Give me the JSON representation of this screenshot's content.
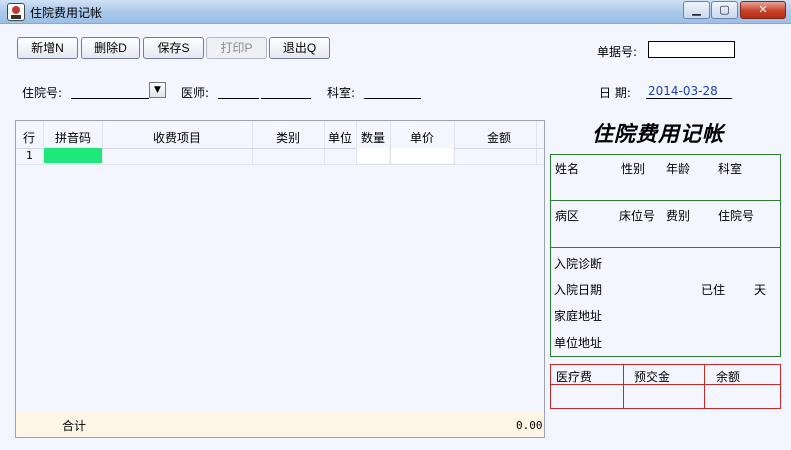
{
  "window": {
    "title": "住院费用记帐",
    "min": "0",
    "max": "1",
    "close": "r"
  },
  "toolbar": {
    "new": "新增N",
    "delete": "删除D",
    "save": "保存S",
    "print": "打印P",
    "exit": "退出Q"
  },
  "form": {
    "receipt_label": "单据号:",
    "inpatient_label": "住院号:",
    "doctor_label": "医师:",
    "dept_label": "科室:",
    "date_label": "日  期:",
    "date_value": "2014-03-28"
  },
  "grid": {
    "columns": [
      "行",
      "拼音码",
      "收费项目",
      "类别",
      "单位",
      "数量",
      "单价",
      "金额"
    ],
    "rows": [
      {
        "row": "1"
      }
    ],
    "total_label": "合计",
    "total_value": "0.00"
  },
  "panel": {
    "title": "住院费用记帐",
    "name": "姓名",
    "gender": "性别",
    "age": "年龄",
    "dept": "科室",
    "ward": "病区",
    "bed": "床位号",
    "fee_type": "费别",
    "inpatient_no": "住院号",
    "diagnosis": "入院诊断",
    "admit_date": "入院日期",
    "stayed": "已住",
    "days": "天",
    "home_addr": "家庭地址",
    "work_addr": "单位地址",
    "medical_fee": "医疗费",
    "prepay": "预交金",
    "balance": "余额"
  }
}
